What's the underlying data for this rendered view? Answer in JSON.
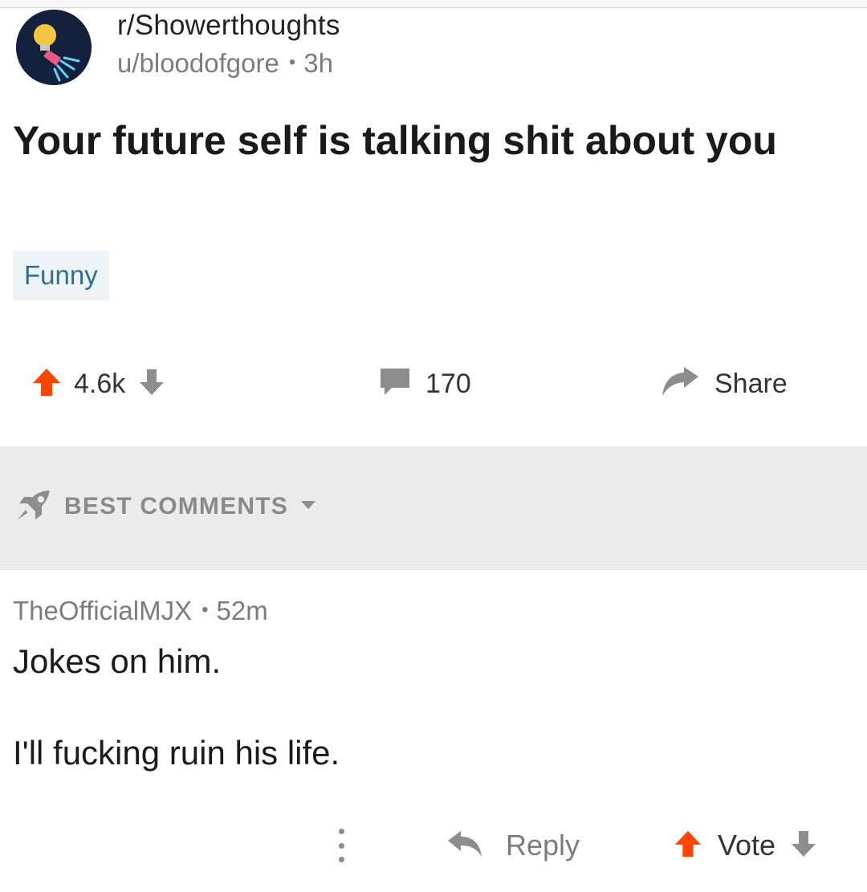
{
  "post": {
    "subreddit": "r/Showerthoughts",
    "author": "u/bloodofgore",
    "separator": "•",
    "age": "3h",
    "title": "Your future self is talking shit about you",
    "flair": "Funny",
    "score": "4.6k",
    "comment_count": "170",
    "share_label": "Share"
  },
  "sort": {
    "label": "BEST COMMENTS"
  },
  "comment": {
    "author": "TheOfficialMJX",
    "separator": "•",
    "age": "52m",
    "line1": "Jokes on him.",
    "line2": "I'll fucking ruin his life.",
    "reply_label": "Reply",
    "vote_label": "Vote"
  },
  "colors": {
    "upvote": "#ff4500",
    "neutral_icon": "#8d8d8d",
    "flair_bg": "#edf3f7",
    "flair_text": "#2c6f94",
    "sort_bg": "#ebebeb"
  },
  "icons": {
    "avatar": "shower-lightbulb-icon",
    "upvote": "arrow-up-icon",
    "downvote": "arrow-down-icon",
    "comments": "speech-bubble-icon",
    "share": "share-arrow-icon",
    "sort": "rocket-icon",
    "caret": "caret-down-icon",
    "more": "vertical-ellipsis-icon",
    "reply": "reply-arrow-icon"
  }
}
